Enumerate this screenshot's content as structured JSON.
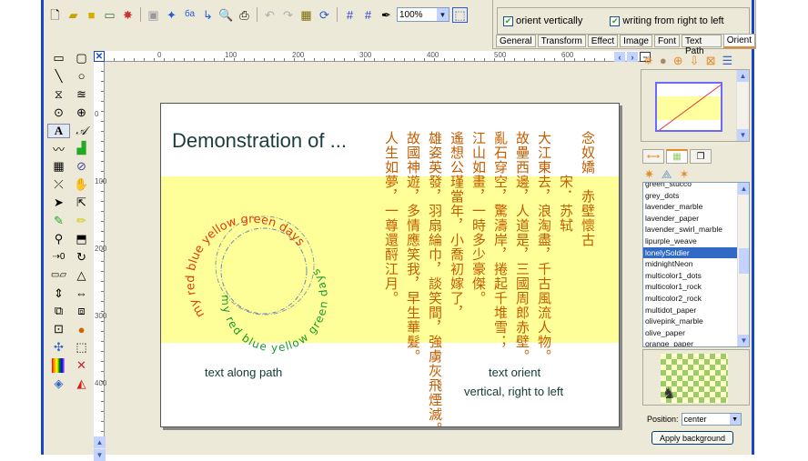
{
  "toolbar": {
    "zoom_value": "100%",
    "icons": [
      "new-icon",
      "open-icon",
      "open-folder-icon",
      "image-icon",
      "chart-icon",
      "save-icon",
      "effects-icon",
      "text-path-icon",
      "arrow-icon",
      "print-preview-icon",
      "print-icon",
      "undo-icon",
      "redo-icon",
      "paste-icon",
      "refresh-icon",
      "grid-icon",
      "snap-grid-icon",
      "pen-icon"
    ]
  },
  "properties": {
    "orient_vertically": {
      "label": "orient vertically",
      "checked": true
    },
    "right_to_left": {
      "label": "writing from right to left",
      "checked": true
    },
    "tabs": [
      "General",
      "Transform",
      "Effect",
      "Image",
      "Font",
      "Text Path",
      "Orient"
    ],
    "active_tab": "Orient"
  },
  "ruler": {
    "h": [
      "0",
      "100",
      "200",
      "300",
      "400",
      "500",
      "600"
    ],
    "v": [
      "0",
      "100",
      "200",
      "300",
      "400"
    ]
  },
  "page": {
    "title": "Demonstration of ...",
    "path_text": "my red blue yellow green days",
    "caption_path": "text along path",
    "caption_orient1": "text orient",
    "caption_orient2": "vertical, right to left",
    "poem": [
      "念奴嬌　赤壁懷古",
      "　　　宋．苏轼",
      "大江東去，浪淘盡，千古風流人物。",
      "故壘西邊，人道是，三國周郎赤壁。",
      "亂石穿空，驚濤岸，捲起千堆雪；",
      "江山如畫，一時多少豪傑。",
      "遙想公瑾當年，小喬初嫁了，",
      "雄姿英發，羽扇綸巾，談笑間，強虜灰飛煙滅。",
      "故國神遊，多情應笑我，早生華髮。",
      "人生如夢，一尊還酹江月。"
    ]
  },
  "background_panel": {
    "items": [
      "green_stucco",
      "grey_dots",
      "lavender_marble",
      "lavender_paper",
      "lavender_swirl_marble",
      "lipurple_weave",
      "lonelySoldier",
      "midnightNeon",
      "multicolor1_dots",
      "multicolor1_rock",
      "multicolor2_rock",
      "multidot_paper",
      "olivepink_marble",
      "olive_paper",
      "orange_paper"
    ],
    "selected": "lonelySoldier",
    "position_label": "Position:",
    "position_value": "center",
    "apply_label": "Apply  background"
  },
  "colors": {
    "path_outer": "#e03c10",
    "path_inner": "#1a9a2a",
    "poem": "#c65c00",
    "band": "#ffff99"
  }
}
